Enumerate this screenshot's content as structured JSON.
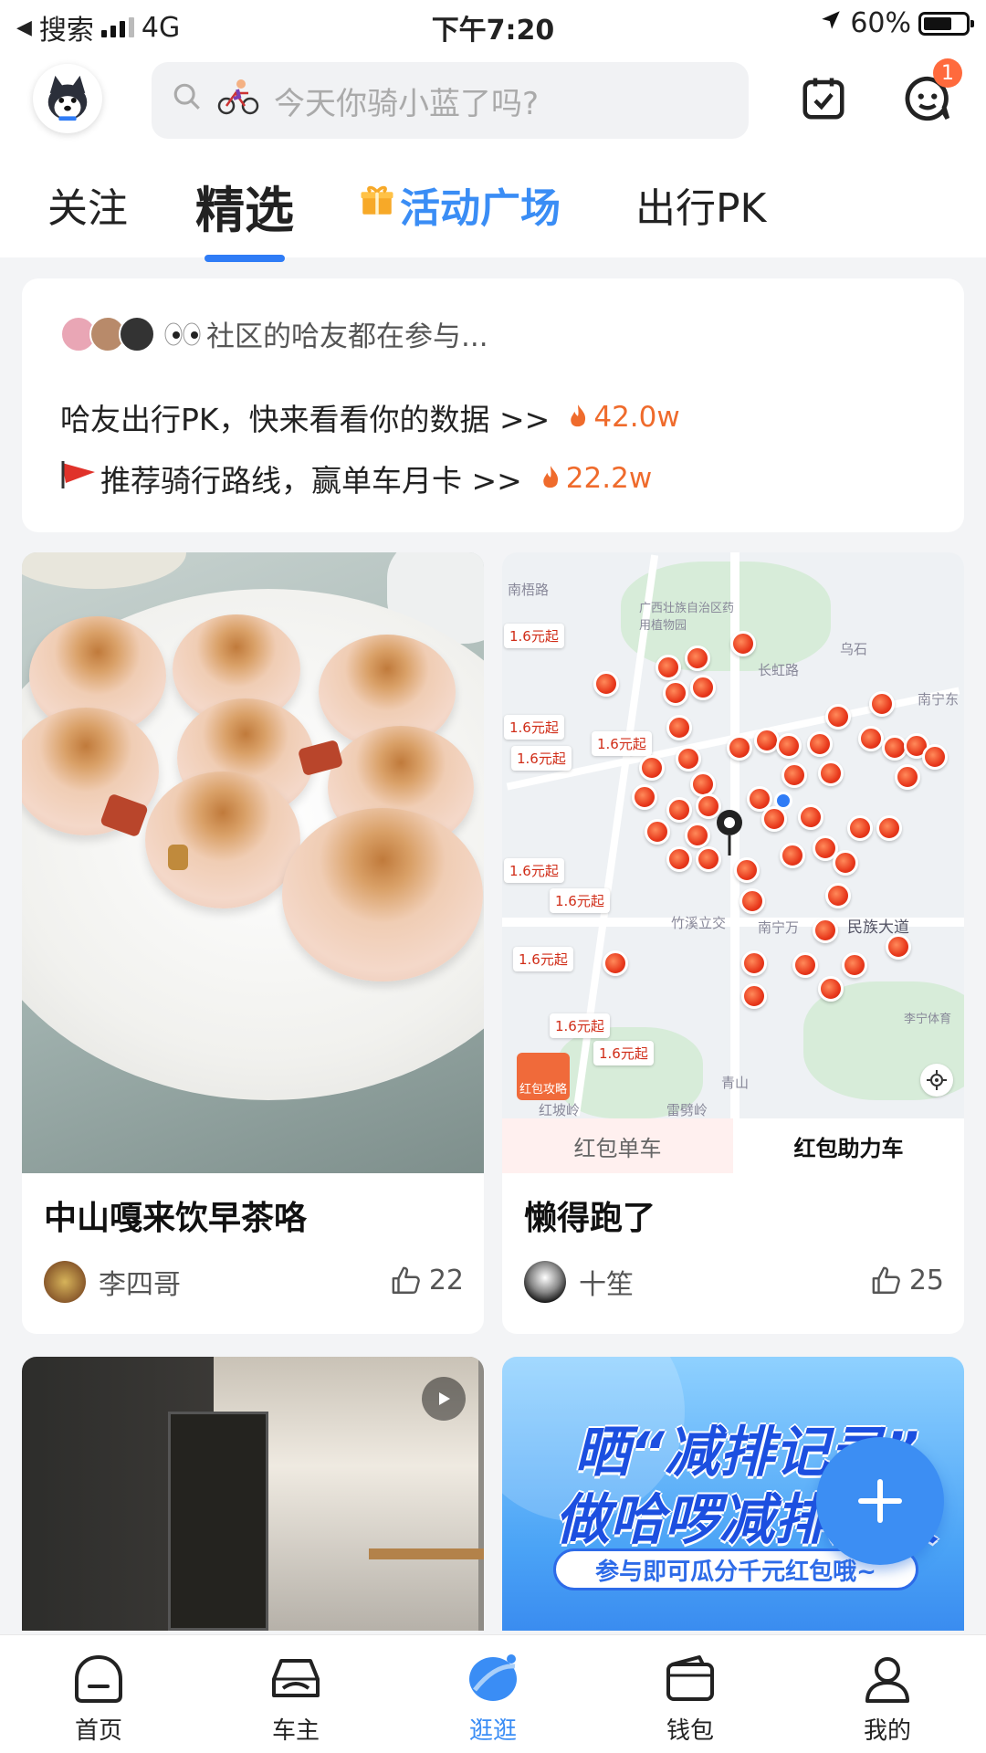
{
  "status_bar": {
    "back_app": "搜索",
    "network": "4G",
    "time": "下午7:20",
    "battery": "60%"
  },
  "header": {
    "search_placeholder": "今天你骑小蓝了吗?",
    "notification_count": "1"
  },
  "tabs": [
    {
      "label": "关注"
    },
    {
      "label": "精选",
      "active": true
    },
    {
      "label": "活动广场"
    },
    {
      "label": "出行PK"
    }
  ],
  "info_card": {
    "participants_text": "社区的哈友都在参与...",
    "line1": {
      "text": "哈友出行PK，快来看看你的数据 >>",
      "hot": "42.0w"
    },
    "line2": {
      "text": "推荐骑行路线，赢单车月卡 >>",
      "hot": "22.2w"
    }
  },
  "posts": [
    {
      "title": "中山嘎来饮早茶咯",
      "author": "李四哥",
      "likes": "22"
    },
    {
      "title": "懒得跑了",
      "author": "十笙",
      "likes": "25",
      "map": {
        "price_label": "1.6元起",
        "place_names": [
          "南梧路",
          "广西壮族自治区药用植物园",
          "长虹路",
          "乌石",
          "南宁东",
          "竹溪立交",
          "南宁万",
          "民族大道",
          "李宁体育",
          "青山",
          "红坡岭",
          "雷劈岭",
          "南"
        ],
        "guide_label": "红包攻略",
        "tabs": [
          "红包单车",
          "红包助力车"
        ]
      }
    }
  ],
  "promo_banner": {
    "line1": "晒“减排记录”",
    "line2": "做哈啰减排达人",
    "cta": "参与即可瓜分千元红包哦~"
  },
  "bottom_nav": [
    {
      "label": "首页"
    },
    {
      "label": "车主"
    },
    {
      "label": "逛逛",
      "active": true
    },
    {
      "label": "钱包"
    },
    {
      "label": "我的"
    }
  ],
  "colors": {
    "accent": "#3a8df5",
    "hot": "#ef6b2c",
    "badge": "#ff6a3d",
    "pin": "#e8391c"
  }
}
